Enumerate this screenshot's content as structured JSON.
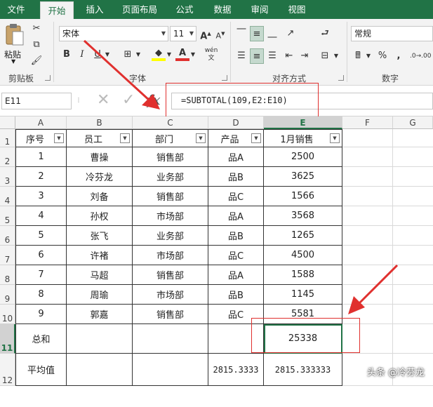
{
  "tabs": [
    "文件",
    "开始",
    "插入",
    "页面布局",
    "公式",
    "数据",
    "审阅",
    "视图"
  ],
  "ribbon": {
    "paste_label": "粘贴",
    "clipboard_label": "剪贴板",
    "font_name": "宋体",
    "font_size": "11",
    "font_group_label": "字体",
    "bold": "B",
    "italic": "I",
    "underline": "U",
    "align_group_label": "对齐方式",
    "number_format": "常规",
    "percent": "%",
    "comma": ",",
    "number_group_label": "数字"
  },
  "formula_bar": {
    "name_box": "E11",
    "fx": "fx",
    "formula": "=SUBTOTAL(109,E2:E10)"
  },
  "columns": [
    "A",
    "B",
    "C",
    "D",
    "E",
    "F",
    "G"
  ],
  "rows": [
    "1",
    "2",
    "3",
    "4",
    "5",
    "6",
    "7",
    "8",
    "9",
    "10",
    "11",
    "12"
  ],
  "headers": [
    "序号",
    "员工",
    "部门",
    "产品",
    "1月销售"
  ],
  "table": [
    [
      "1",
      "曹操",
      "销售部",
      "品A",
      "2500"
    ],
    [
      "2",
      "冷芬龙",
      "业务部",
      "品B",
      "3625"
    ],
    [
      "3",
      "刘备",
      "销售部",
      "品C",
      "1566"
    ],
    [
      "4",
      "孙权",
      "市场部",
      "品A",
      "3568"
    ],
    [
      "5",
      "张飞",
      "业务部",
      "品B",
      "1265"
    ],
    [
      "6",
      "许褚",
      "市场部",
      "品C",
      "4500"
    ],
    [
      "7",
      "马超",
      "销售部",
      "品A",
      "1588"
    ],
    [
      "8",
      "周瑜",
      "市场部",
      "品B",
      "1145"
    ],
    [
      "9",
      "郭嘉",
      "销售部",
      "品C",
      "5581"
    ]
  ],
  "total_row": {
    "label": "总和",
    "value": "25338"
  },
  "avg_row": {
    "label": "平均值",
    "d": "2815.3333",
    "e": "2815.333333"
  },
  "watermark": "头条 @冷芬龙",
  "colors": {
    "excel_green": "#217346",
    "annotation_red": "#e0302e"
  }
}
